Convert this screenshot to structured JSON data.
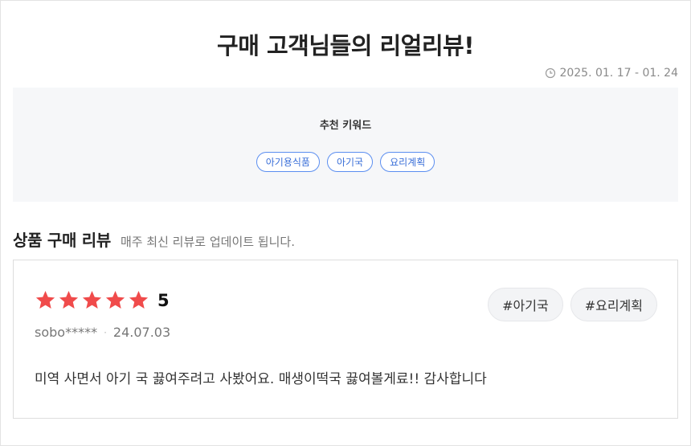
{
  "header": {
    "title": "구매 고객님들의 리얼리뷰!",
    "period": "2025. 01. 17 - 01. 24",
    "period_icon": "clock-icon"
  },
  "keywords": {
    "title": "추천 키워드",
    "items": [
      "아기용식품",
      "아기국",
      "요리계획"
    ],
    "accent_color": "#3a6fd8"
  },
  "reviews_section": {
    "title": "상품 구매 리뷰",
    "description": "매주 최신 리뷰로 업데이트 됩니다."
  },
  "review": {
    "rating": "5",
    "stars": 5,
    "star_color": "#f04b4b",
    "author": "sobo*****",
    "separator": "·",
    "date": "24.07.03",
    "tags": [
      "#아기국",
      "#요리계획"
    ],
    "text": "미역 사면서 아기 국 끓여주려고 사봤어요. 매생이떡국 끓여볼게료!! 감사합니다"
  }
}
